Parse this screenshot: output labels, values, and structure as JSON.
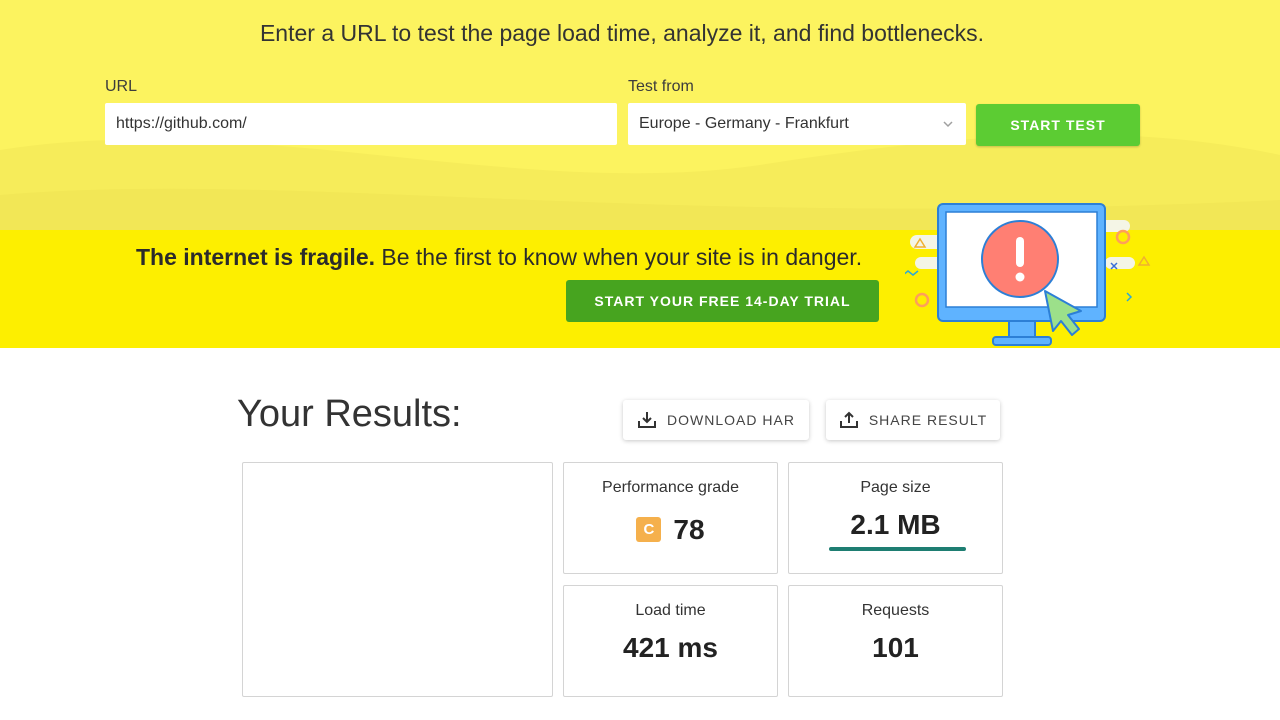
{
  "test_form": {
    "title": "Enter a URL to test the page load time, analyze it, and find bottlenecks.",
    "url_label": "URL",
    "url_value": "https://github.com/",
    "location_label": "Test from",
    "location_value": "Europe - Germany - Frankfurt",
    "start_label": "START TEST"
  },
  "banner": {
    "bold_text": "The internet is fragile.",
    "text": " Be the first to know when your site is in danger.",
    "trial_label": "START YOUR FREE 14-DAY TRIAL"
  },
  "results": {
    "title": "Your Results:",
    "download_label": "DOWNLOAD HAR",
    "share_label": "SHARE RESULT",
    "performance": {
      "label": "Performance grade",
      "grade": "C",
      "score": "78",
      "grade_color": "#f5b04c"
    },
    "page_size": {
      "label": "Page size",
      "value": "2.1 MB",
      "bar_color": "#1e7e72"
    },
    "load_time": {
      "label": "Load time",
      "value": "421 ms"
    },
    "requests": {
      "label": "Requests",
      "value": "101"
    }
  },
  "icons": {
    "dropdown": "chevron-down-icon",
    "download": "download-icon",
    "share": "share-icon",
    "illustration": "monitor-alert-illustration"
  },
  "colors": {
    "hero_bg": "#fcf35f",
    "banner_bg": "#fdef00",
    "start_button": "#5ccc33",
    "trial_button": "#47a41f"
  }
}
